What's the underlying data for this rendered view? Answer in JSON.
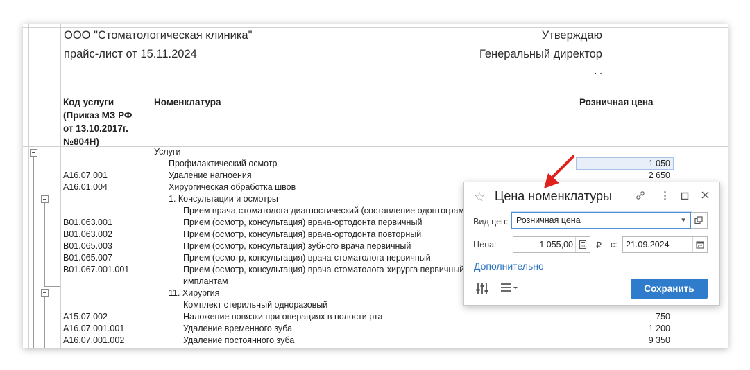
{
  "header": {
    "org": "ООО \"Стоматологическая клиника\"",
    "pricelist": "прайс-лист от 15.11.2024",
    "approve": "Утверждаю",
    "director": "Генеральный директор",
    "dots": ". ."
  },
  "columns": {
    "code": [
      "Код услуги",
      "(Приказ МЗ РФ",
      "от 13.10.2017г.",
      "№804Н)"
    ],
    "name": "Номенклатура",
    "price": "Розничная цена"
  },
  "rows": [
    {
      "code": "",
      "name": "Услуги",
      "price": ""
    },
    {
      "code": "",
      "name": "Профилактический осмотр",
      "price": "1 050"
    },
    {
      "code": "A16.07.001",
      "name": "Удаление нагноения",
      "price": "2 650"
    },
    {
      "code": "A16.01.004",
      "name": "Хирургическая обработка швов",
      "price": ""
    },
    {
      "code": "",
      "name": "1. Консультации и осмотры",
      "price": ""
    },
    {
      "code": "",
      "name": "Прием врача-стоматолога диагностический (составление одонтограммы",
      "price": ""
    },
    {
      "code": "B01.063.001",
      "name": "Прием (осмотр, консультация) врача-ортодонта первичный",
      "price": ""
    },
    {
      "code": "B01.063.002",
      "name": "Прием (осмотр, консультация) врача-ортодонта повторный",
      "price": ""
    },
    {
      "code": "B01.065.003",
      "name": "Прием (осмотр, консультация) зубного врача первичный",
      "price": ""
    },
    {
      "code": "B01.065.007",
      "name": "Прием (осмотр, консультация) врача-стоматолога первичный",
      "price": ""
    },
    {
      "code": "B01.067.001.001",
      "name": "Прием (осмотр, консультация) врача-стоматолога-хирурга первичный",
      "price": ""
    },
    {
      "code": "",
      "name": "имплантам",
      "price": ""
    },
    {
      "code": "",
      "name": "11. Хирургия",
      "price": ""
    },
    {
      "code": "",
      "name": "Комплект стерильный одноразовый",
      "price": ""
    },
    {
      "code": "A15.07.002",
      "name": "Наложение повязки при операциях в полости рта",
      "price": "750"
    },
    {
      "code": "A16.07.001.001",
      "name": "Удаление временного зуба",
      "price": "1 200"
    },
    {
      "code": "A16.07.001.002",
      "name": "Удаление постоянного зуба",
      "price": "9 350"
    }
  ],
  "popup": {
    "title": "Цена номенклатуры",
    "price_type_label": "Вид цен:",
    "price_type_value": "Розничная цена",
    "price_label": "Цена:",
    "price_value": "1 055,00",
    "currency": "₽",
    "from_label": "с:",
    "date_value": "21.09.2024",
    "more_link": "Дополнительно",
    "save_label": "Сохранить"
  },
  "colors": {
    "accent": "#2f7ccd",
    "link": "#2a72c2",
    "arrow": "#e0201b"
  }
}
